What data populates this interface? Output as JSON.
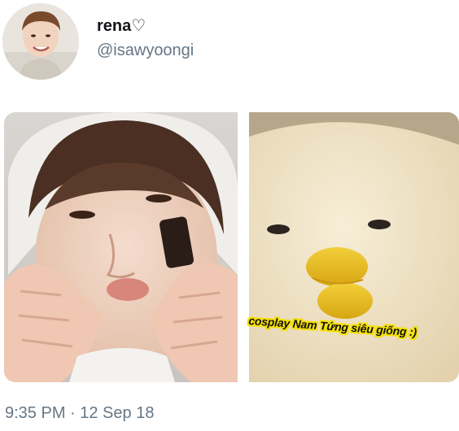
{
  "tweet": {
    "display_name": "rena",
    "name_heart": "♡",
    "handle": "@isawyoongi",
    "timestamp": "9:35 PM · 12 Sep 18",
    "media": {
      "left_image": "photo-person-face-squished",
      "right_image": "photo-duck-plush-toy",
      "caption": "cosplay Nam Tứng siêu giống :)"
    },
    "colors": {
      "name": "#14171a",
      "secondary_text": "#657786",
      "caption_highlight": "#f5e000"
    }
  }
}
